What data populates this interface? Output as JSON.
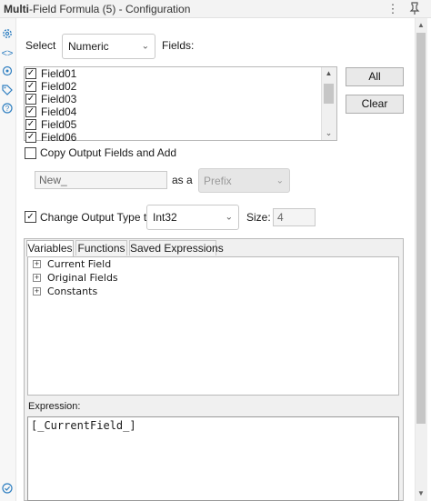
{
  "window": {
    "title_bold": "Multi",
    "title_rest": "-Field Formula (5) - Configuration",
    "menu_icon": "kebab-menu-icon",
    "pin_icon": "pin-icon"
  },
  "rail": {
    "icons": [
      "gear-icon",
      "code-icon",
      "target-icon",
      "tag-icon",
      "help-icon"
    ],
    "bottom_icon": "check-circle-icon"
  },
  "select_row": {
    "select_label": "Select",
    "select_value": "Numeric",
    "fields_label": "Fields:"
  },
  "fields": [
    {
      "name": "Field01",
      "checked": true
    },
    {
      "name": "Field02",
      "checked": true
    },
    {
      "name": "Field03",
      "checked": true
    },
    {
      "name": "Field04",
      "checked": true
    },
    {
      "name": "Field05",
      "checked": true
    },
    {
      "name": "Field06",
      "checked": true
    }
  ],
  "buttons": {
    "all": "All",
    "clear": "Clear"
  },
  "copy_output": {
    "label": "Copy Output Fields and Add",
    "checked": false,
    "name_value": "New_",
    "as_a_label": "as a",
    "position_value": "Prefix"
  },
  "change_type": {
    "label": "Change Output Type to",
    "checked": true,
    "type_value": "Int32",
    "size_label": "Size:",
    "size_value": "4"
  },
  "tabs": [
    {
      "label": "Variables",
      "active": true
    },
    {
      "label": "Functions",
      "active": false
    },
    {
      "label": "Saved Expressions",
      "active": false
    }
  ],
  "tree": [
    {
      "label": "Current Field"
    },
    {
      "label": "Original Fields"
    },
    {
      "label": "Constants"
    }
  ],
  "expression": {
    "label": "Expression:",
    "value": "[_CurrentField_]"
  },
  "colors": {
    "accent": "#2f7fc1",
    "border": "#b9b9b9",
    "panel_bg": "#f0f0f0"
  }
}
